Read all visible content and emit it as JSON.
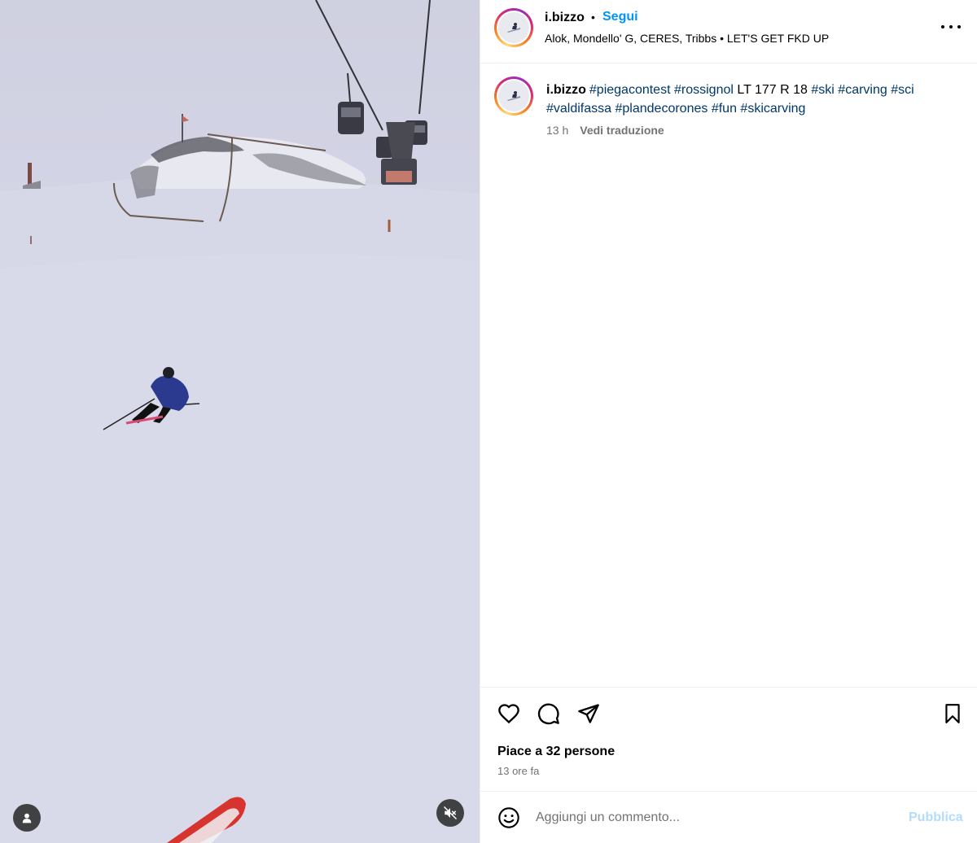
{
  "post": {
    "username": "i.bizzo",
    "separator": "•",
    "follow_label": "Segui",
    "audio": "Alok, Mondello' G, CERES, Tribbs • LET'S GET FKD UP",
    "caption": {
      "username": "i.bizzo",
      "parts": [
        {
          "text": "#piegacontest",
          "tag": true
        },
        {
          "text": " ",
          "tag": false
        },
        {
          "text": "#rossignol",
          "tag": true
        },
        {
          "text": " LT 177 R 18 ",
          "tag": false
        },
        {
          "text": "#ski",
          "tag": true
        },
        {
          "text": " ",
          "tag": false
        },
        {
          "text": "#carving",
          "tag": true
        },
        {
          "text": " ",
          "tag": false
        },
        {
          "text": "#sci",
          "tag": true
        },
        {
          "text": " ",
          "tag": false
        },
        {
          "text": "#valdifassa",
          "tag": true
        },
        {
          "text": " ",
          "tag": false
        },
        {
          "text": "#plandecorones",
          "tag": true
        },
        {
          "text": " ",
          "tag": false
        },
        {
          "text": "#fun",
          "tag": true
        },
        {
          "text": " ",
          "tag": false
        },
        {
          "text": "#skicarving",
          "tag": true
        }
      ],
      "age": "13 h",
      "translate_label": "Vedi traduzione"
    },
    "likes": "Piace a 32 persone",
    "time": "13 ore fa"
  },
  "comment": {
    "placeholder": "Aggiungi un commento...",
    "publish_label": "Pubblica"
  },
  "icons": {
    "more": "more-options-icon",
    "like": "heart-icon",
    "comment": "comment-icon",
    "share": "paper-plane-icon",
    "save": "bookmark-icon",
    "emoji": "emoji-icon",
    "tagged_people": "user-icon",
    "mute": "speaker-muted-icon"
  },
  "colors": {
    "link": "#0095f6",
    "hashtag": "#00376b",
    "secondary_text": "#737373",
    "publish_disabled": "#b3dbff"
  }
}
